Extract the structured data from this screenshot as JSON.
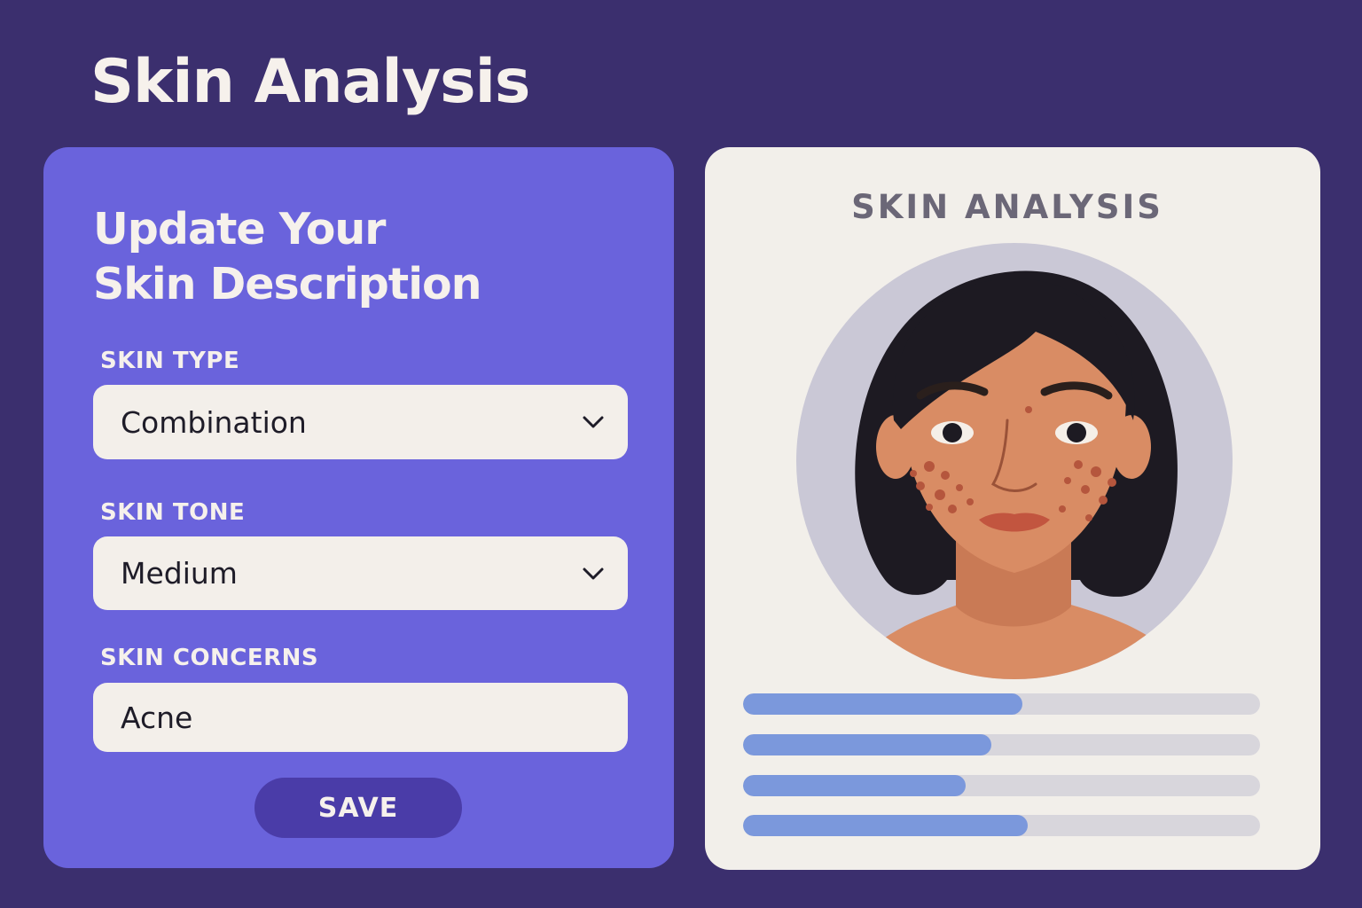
{
  "header": {
    "title": "Skin Analysis"
  },
  "form": {
    "title_line1": "Update Your",
    "title_line2": "Skin Description",
    "skin_type": {
      "label": "SKIN TYPE",
      "value": "Combination"
    },
    "skin_tone": {
      "label": "SKIN TONE",
      "value": "Medium"
    },
    "skin_concerns": {
      "label": "SKIN CONCERNS",
      "value": "Acne"
    },
    "save_label": "SAVE"
  },
  "analysis": {
    "title": "SKIN ANALYSIS",
    "portrait": "illustrated-face-with-acne",
    "bars": [
      {
        "fraction": 0.54
      },
      {
        "fraction": 0.48
      },
      {
        "fraction": 0.43
      },
      {
        "fraction": 0.55
      }
    ]
  },
  "colors": {
    "background": "#3b2f6e",
    "form_card": "#6a63dc",
    "save_button": "#4a3ca8",
    "bar_fill": "#7b98dc",
    "bar_track": "#d8d6dc"
  }
}
